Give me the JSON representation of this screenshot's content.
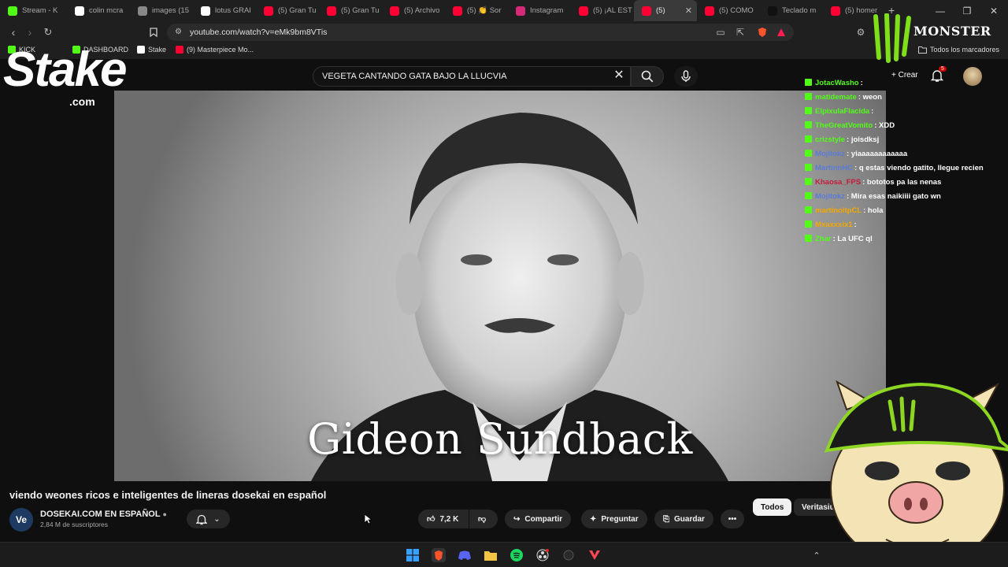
{
  "browser": {
    "tabs": [
      {
        "label": "Stream - K",
        "icon": "kick-icon",
        "color": "#53fc18"
      },
      {
        "label": "colin mcra",
        "icon": "google-icon",
        "color": "#ffffff"
      },
      {
        "label": "images (15",
        "icon": "globe-icon",
        "color": "#888888"
      },
      {
        "label": "lotus GRAI",
        "icon": "google-icon",
        "color": "#ffffff"
      },
      {
        "label": "(5) Gran Tu",
        "icon": "youtube-icon",
        "color": "#ff0033"
      },
      {
        "label": "(5) Gran Tu",
        "icon": "youtube-icon",
        "color": "#ff0033"
      },
      {
        "label": "(5) Archivo",
        "icon": "youtube-icon",
        "color": "#ff0033"
      },
      {
        "label": "(5) 👏 Sor",
        "icon": "youtube-icon",
        "color": "#ff0033"
      },
      {
        "label": "Instagram",
        "icon": "instagram-icon",
        "color": "#d62976"
      },
      {
        "label": "(5) ¡AL EST",
        "icon": "youtube-icon",
        "color": "#ff0033"
      },
      {
        "label": "(5)",
        "icon": "youtube-icon",
        "color": "#ff0033"
      },
      {
        "label": "(5) COMO",
        "icon": "youtube-icon",
        "color": "#ff0033"
      },
      {
        "label": "Teclado m",
        "icon": "triangle-icon",
        "color": "#111111"
      },
      {
        "label": "(5) homer",
        "icon": "youtube-icon",
        "color": "#ff0033"
      }
    ],
    "url": "youtube.com/watch?v=eMk9bm8VTis",
    "bookmarks": [
      {
        "label": "KICK",
        "color": "#53fc18"
      },
      {
        "label": "DASHBOARD",
        "color": "#53fc18"
      },
      {
        "label": "Stake",
        "color": "#ffffff"
      },
      {
        "label": "(9) Masterpiece Mo...",
        "color": "#ff0033"
      }
    ],
    "all_bookmarks": "Todos los marcadores"
  },
  "youtube": {
    "search_query": "VEGETA CANTANDO GATA BAJO LA LLUCVIA",
    "create_label": "Crear",
    "notifications": "5",
    "video_overlay_title": "Gideon Sundback",
    "video_title": "viendo weones ricos e inteligentes de lineras dosekai en español",
    "channel": {
      "avatar": "Ve",
      "name": "DOSEKAI.COM  EN ESPAÑOL",
      "subscribers": "2,84 M de suscriptores"
    },
    "actions": {
      "likes": "7,2 K",
      "share": "Compartir",
      "ask": "Preguntar",
      "save": "Guardar"
    },
    "chips": {
      "all": "Todos",
      "other": "Veritasiu"
    }
  },
  "overlay": {
    "stake_logo": "Stake",
    "stake_com": ".com",
    "monster_brand": "MONSTER"
  },
  "chat": [
    {
      "user": "JotacWasho",
      "color": "#53fc18",
      "text": ":"
    },
    {
      "user": "matidemate",
      "color": "#53fc18",
      "text": ": weon"
    },
    {
      "user": "ElpixulaFlacida",
      "color": "#53fc18",
      "text": ":"
    },
    {
      "user": "TheGreatVomito",
      "color": "#53fc18",
      "text": ": XDD"
    },
    {
      "user": "crizstyle",
      "color": "#53fc18",
      "text": ": joisdksj"
    },
    {
      "user": "Mojitokz",
      "color": "#5b7bd8",
      "text": ": yiaaaaaaaaaaaa"
    },
    {
      "user": "MartinnHC",
      "color": "#5b7bd8",
      "text": ": q estas viendo gatito, llegue recien"
    },
    {
      "user": "Khaosa_FPS",
      "color": "#c41c3b",
      "text": ": bototos pa las nenas"
    },
    {
      "user": "Mojitokz",
      "color": "#5b7bd8",
      "text": ": Mira esas naikiiii gato wn"
    },
    {
      "user": "martinoitpCL",
      "color": "#f2a900",
      "text": ": hola"
    },
    {
      "user": "Mxaxxxix1",
      "color": "#f2a900",
      "text": ":"
    },
    {
      "user": "Zhar",
      "color": "#53fc18",
      "text": ": La UFC ql"
    }
  ]
}
